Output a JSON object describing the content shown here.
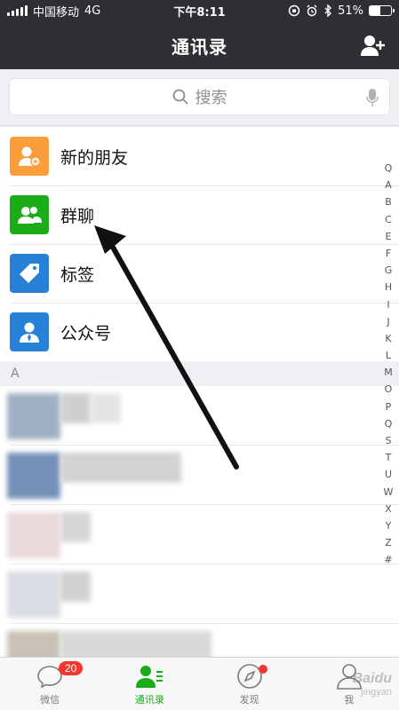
{
  "status_bar": {
    "carrier": "中国移动",
    "network": "4G",
    "time": "下午8:11",
    "battery_percent": "51%",
    "battery_level": 0.51
  },
  "nav": {
    "title": "通讯录",
    "add_icon": "add-contact-icon"
  },
  "search": {
    "placeholder": "搜索",
    "search_icon": "search-icon",
    "mic_icon": "microphone-icon"
  },
  "menu": [
    {
      "label": "新的朋友",
      "icon": "new-friend-icon",
      "color": "#fa9d3b"
    },
    {
      "label": "群聊",
      "icon": "group-chat-icon",
      "color": "#1aad19"
    },
    {
      "label": "标签",
      "icon": "tag-icon",
      "color": "#2782d7"
    },
    {
      "label": "公众号",
      "icon": "official-account-icon",
      "color": "#2782d7"
    }
  ],
  "section": {
    "letter": "A"
  },
  "index_letters": [
    "Q",
    "A",
    "B",
    "C",
    "E",
    "F",
    "G",
    "H",
    "I",
    "J",
    "K",
    "L",
    "M",
    "O",
    "P",
    "Q",
    "S",
    "T",
    "U",
    "W",
    "X",
    "Y",
    "Z",
    "#"
  ],
  "tabs": [
    {
      "label": "微信",
      "icon": "chat-bubble-icon",
      "badge": "20",
      "active": false
    },
    {
      "label": "通讯录",
      "icon": "contacts-icon",
      "active": true
    },
    {
      "label": "发现",
      "icon": "compass-icon",
      "dot": true,
      "active": false
    },
    {
      "label": "我",
      "icon": "me-icon",
      "active": false
    }
  ],
  "colors": {
    "header_bg": "#2e2e33",
    "accent_green": "#1aad19",
    "badge_red": "#f43530"
  },
  "watermark": {
    "text": "Baidu",
    "sub": "jingyan"
  }
}
